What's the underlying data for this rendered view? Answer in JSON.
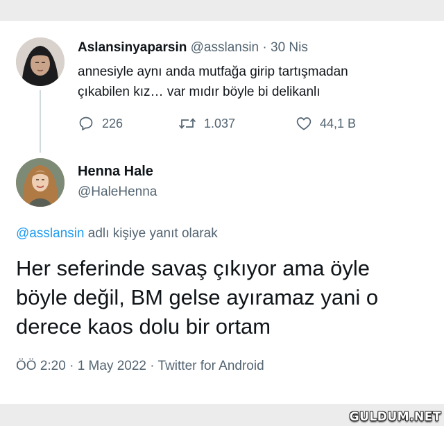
{
  "original_tweet": {
    "display_name": "Aslansinyaparsin",
    "handle": "@asslansin",
    "separator": "·",
    "date": "30 Nis",
    "text_lines": [
      "annesiyle aynı anda mutfağa girip tartışmadan",
      "çıkabilen kız… var mıdır böyle bi delikanlı"
    ],
    "reply_count": "226",
    "retweet_count": "1.037",
    "like_count": "44,1 B",
    "icons": [
      "reply-icon",
      "retweet-icon",
      "like-icon"
    ]
  },
  "reply_tweet": {
    "display_name": "Henna Hale",
    "handle": "@HaleHenna",
    "replying_mention": "@asslansin",
    "replying_suffix": "adlı kişiye yanıt olarak",
    "text_lines": [
      "Her seferinde savaş çıkıyor ama öyle",
      "böyle değil, BM gelse ayıramaz yani o",
      "derece kaos dolu bir ortam"
    ],
    "meta": "ÖÖ 2:20 · 1 May 2022 · Twitter for Android"
  },
  "colors": {
    "accent": "#1d9bf0",
    "text": "#0f1419",
    "muted": "#536471",
    "background": "#ececec"
  },
  "watermark": "GULDUM.NET"
}
